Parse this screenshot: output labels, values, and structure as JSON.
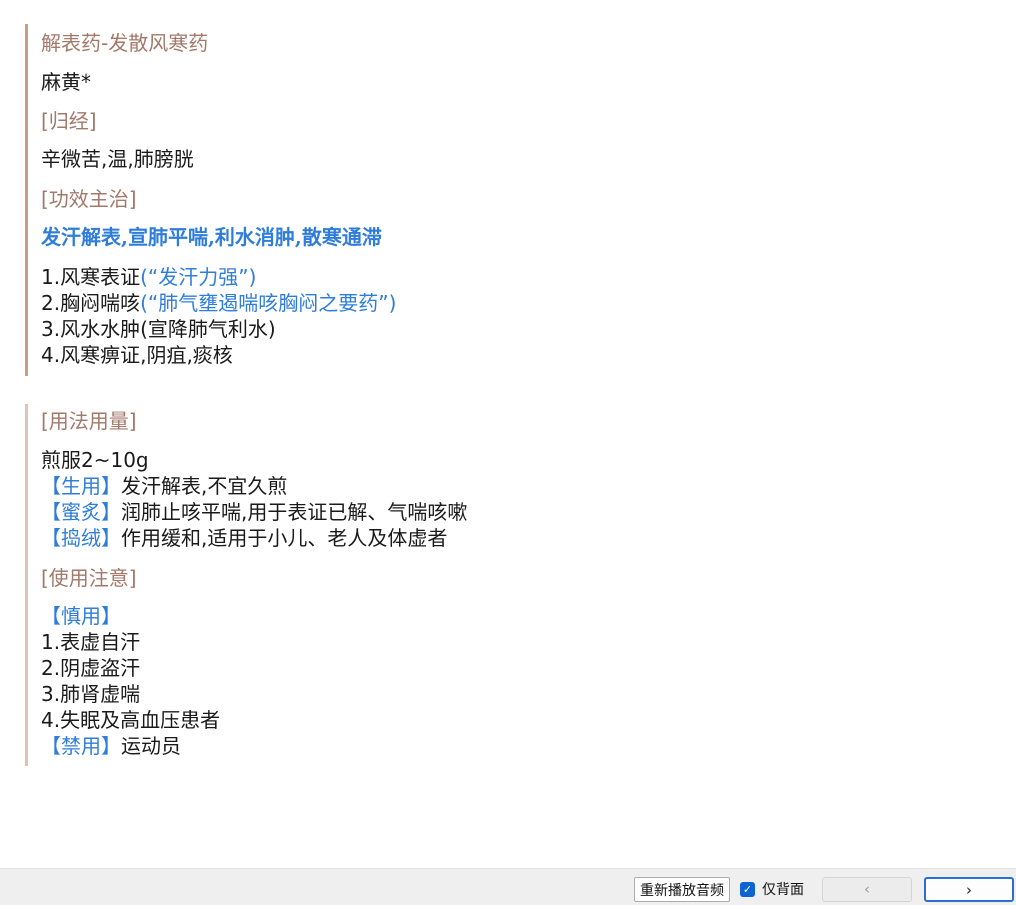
{
  "card": {
    "category": "解表药-发散风寒药",
    "herb_name": "麻黄*",
    "meridian": {
      "heading": "[归经]",
      "text": "辛微苦,温,肺膀胱"
    },
    "effects": {
      "heading": "[功效主治]",
      "summary": "发汗解表,宣肺平喘,利水消肿,散寒通滞",
      "items": [
        {
          "main": "1.风寒表证",
          "note": "(“发汗力强”)"
        },
        {
          "main": "2.胸闷喘咳",
          "note": "(“肺气壅遏喘咳胸闷之要药”)"
        },
        {
          "main": "3.风水水肿(宣降肺气利水)",
          "note": ""
        },
        {
          "main": "4.风寒痹证,阴疽,痰核",
          "note": ""
        }
      ]
    },
    "usage": {
      "heading": "[用法用量]",
      "dosage": "煎服2~10g",
      "forms": [
        {
          "tag": "【生用】",
          "text": "发汗解表,不宜久煎"
        },
        {
          "tag": "【蜜炙】",
          "text": "润肺止咳平喘,用于表证已解、气喘咳嗽"
        },
        {
          "tag": "【捣绒】",
          "text": "作用缓和,适用于小儿、老人及体虚者"
        }
      ]
    },
    "cautions": {
      "heading": "[使用注意]",
      "caution_tag": "【慎用】",
      "caution_items": [
        "1.表虚自汗",
        "2.阴虚盗汗",
        "3.肺肾虚喘",
        "4.失眠及高血压患者"
      ],
      "forbidden_tag": "【禁用】",
      "forbidden_text": "运动员"
    }
  },
  "footer": {
    "replay_audio_label": "重新播放音频",
    "back_only_label": "仅背面",
    "back_only_checked": true,
    "prev_label": "‹",
    "next_label": "›"
  },
  "colors": {
    "heading": "#a2796a",
    "highlight": "#2f7ddb",
    "section_border": "#d8c5b6",
    "checkbox": "#0c63d4",
    "next_border": "#2b6fd6"
  }
}
